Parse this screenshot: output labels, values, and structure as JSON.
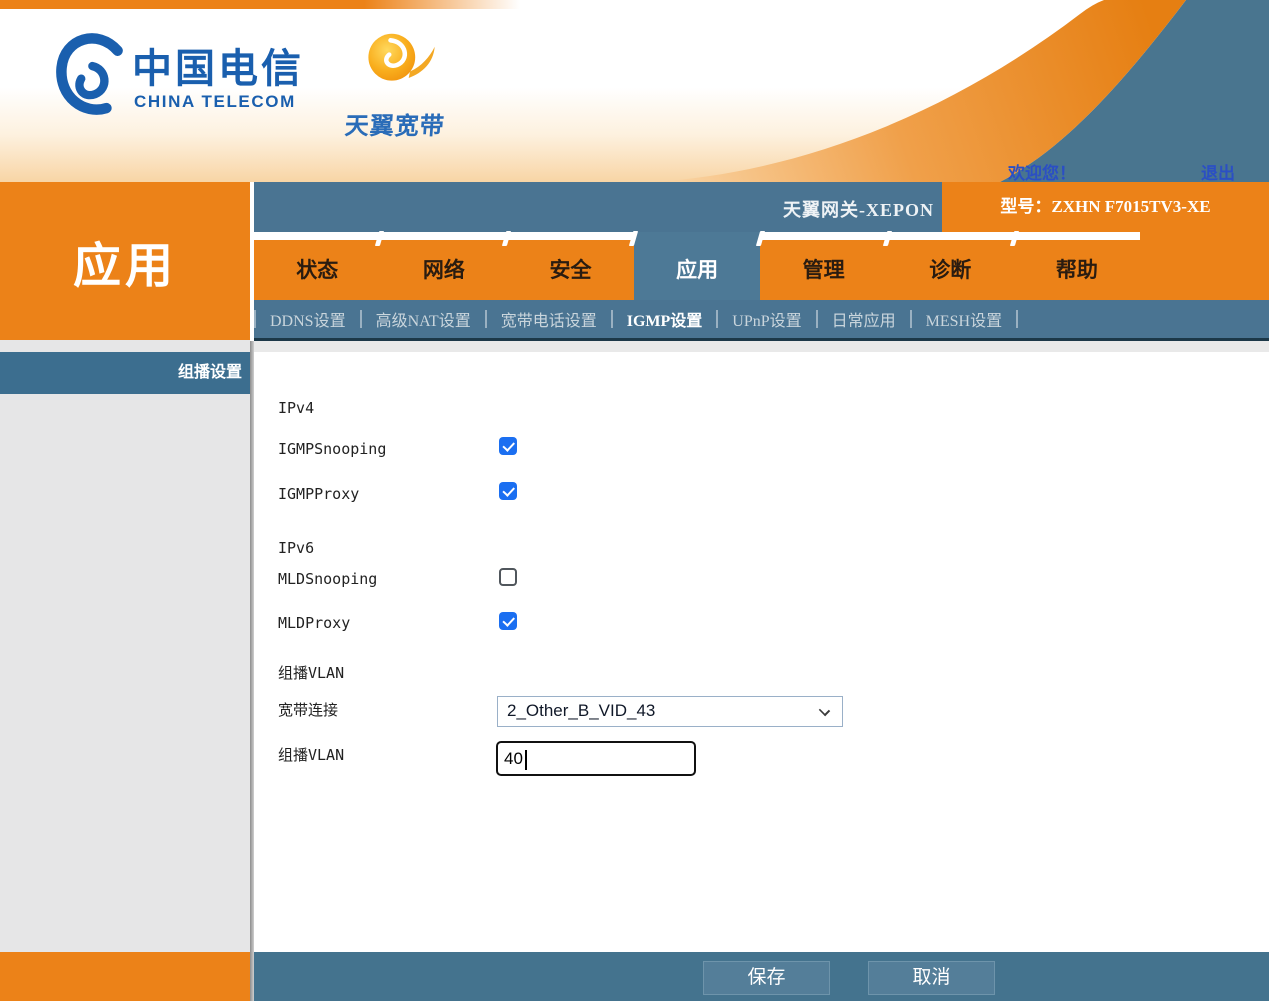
{
  "brand": {
    "telecom_cn": "中国电信",
    "telecom_en": "CHINA TELECOM",
    "broadband": "天翼宽带"
  },
  "header": {
    "welcome": "欢迎您！",
    "logout": "退出"
  },
  "titlebar": {
    "gateway_name": "天翼网关-XEPON",
    "model": "型号：ZXHN F7015TV3-XE"
  },
  "nav": {
    "tabs": [
      "状态",
      "网络",
      "安全",
      "应用",
      "管理",
      "诊断",
      "帮助"
    ],
    "active_tab": "应用"
  },
  "submenu": {
    "items": [
      "DDNS设置",
      "高级NAT设置",
      "宽带电话设置",
      "IGMP设置",
      "UPnP设置",
      "日常应用",
      "MESH设置"
    ],
    "active": "IGMP设置"
  },
  "sidebar": {
    "section": "应用",
    "items": [
      "组播设置"
    ]
  },
  "form": {
    "ipv4": {
      "title": "IPv4",
      "igmp_snooping": {
        "label": "IGMPSnooping",
        "checked": true
      },
      "igmp_proxy": {
        "label": "IGMPProxy",
        "checked": true
      }
    },
    "ipv6": {
      "title": "IPv6",
      "mld_snooping": {
        "label": "MLDSnooping",
        "checked": false
      },
      "mld_proxy": {
        "label": "MLDProxy",
        "checked": true
      }
    },
    "vlan": {
      "title": "组播VLAN",
      "connection": {
        "label": "宽带连接",
        "value": "2_Other_B_VID_43"
      },
      "vlan_id": {
        "label": "组播VLAN",
        "value": "40"
      }
    }
  },
  "footer": {
    "save": "保存",
    "cancel": "取消"
  },
  "colors": {
    "orange": "#ec8218",
    "steel_blue": "#4a7492",
    "checkbox_blue": "#1b6ff1",
    "link_blue": "#2b4fc4",
    "submenu_divider": "#1c3848"
  }
}
